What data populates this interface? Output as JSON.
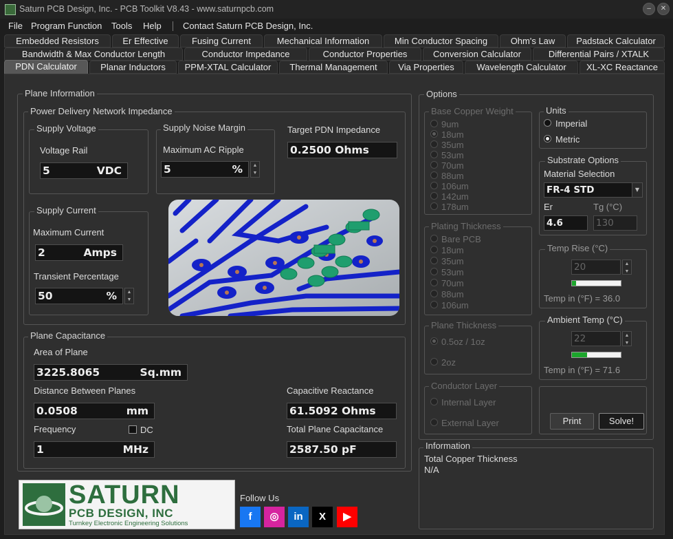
{
  "window": {
    "title": "Saturn PCB Design, Inc. - PCB Toolkit V8.43 - www.saturnpcb.com",
    "minimize": "–",
    "close": "✕"
  },
  "menu": [
    "File",
    "Program Function",
    "Tools",
    "Help",
    "Contact Saturn PCB Design, Inc."
  ],
  "tabs_row1": [
    "Embedded Resistors",
    "Er Effective",
    "Fusing Current",
    "Mechanical Information",
    "Min Conductor Spacing",
    "Ohm's Law",
    "Padstack Calculator"
  ],
  "tabs_row2": [
    "Bandwidth & Max Conductor Length",
    "Conductor Impedance",
    "Conductor Properties",
    "Conversion Calculator",
    "Differential Pairs / XTALK"
  ],
  "tabs_row3": [
    "PDN Calculator",
    "Planar Inductors",
    "PPM-XTAL Calculator",
    "Thermal Management",
    "Via Properties",
    "Wavelength Calculator",
    "XL-XC Reactance"
  ],
  "plane_info": {
    "title": "Plane Information",
    "pdn": {
      "title": "Power Delivery Network Impedance",
      "supply_voltage": {
        "title": "Supply Voltage",
        "label": "Voltage Rail",
        "value": "5",
        "unit": "VDC"
      },
      "noise_margin": {
        "title": "Supply Noise Margin",
        "label": "Maximum AC Ripple",
        "value": "5",
        "unit": "%"
      },
      "target": {
        "label": "Target PDN Impedance",
        "value": "0.2500 Ohms"
      },
      "supply_current": {
        "title": "Supply Current",
        "max_label": "Maximum Current",
        "max_value": "2",
        "max_unit": "Amps",
        "transient_label": "Transient Percentage",
        "transient_value": "50",
        "transient_unit": "%"
      }
    },
    "capacitance": {
      "title": "Plane Capacitance",
      "area_label": "Area of Plane",
      "area_value": "3225.8065",
      "area_unit": "Sq.mm",
      "distance_label": "Distance Between Planes",
      "distance_value": "0.0508",
      "distance_unit": "mm",
      "frequency_label": "Frequency",
      "frequency_value": "1",
      "frequency_unit": "MHz",
      "dc_label": "DC",
      "reactance_label": "Capacitive Reactance",
      "reactance_value": "61.5092 Ohms",
      "total_label": "Total Plane Capacitance",
      "total_value": "2587.50 pF"
    }
  },
  "logo": {
    "line1": "SATURN",
    "line2": "PCB DESIGN, INC",
    "line3": "Turnkey Electronic Engineering Solutions"
  },
  "follow": {
    "label": "Follow Us",
    "icons": [
      "f",
      "◎",
      "in",
      "X",
      "▶"
    ]
  },
  "options": {
    "title": "Options",
    "base_copper": {
      "title": "Base Copper Weight",
      "items": [
        "9um",
        "18um",
        "35um",
        "53um",
        "70um",
        "88um",
        "106um",
        "142um",
        "178um"
      ],
      "selected": "18um"
    },
    "plating": {
      "title": "Plating Thickness",
      "items": [
        "Bare PCB",
        "18um",
        "35um",
        "53um",
        "70um",
        "88um",
        "106um"
      ]
    },
    "plane_thickness": {
      "title": "Plane Thickness",
      "items": [
        "0.5oz / 1oz",
        "2oz"
      ],
      "selected": "0.5oz / 1oz"
    },
    "conductor_layer": {
      "title": "Conductor Layer",
      "items": [
        "Internal Layer",
        "External Layer"
      ]
    },
    "units": {
      "title": "Units",
      "items": [
        "Imperial",
        "Metric"
      ],
      "selected": "Metric"
    },
    "substrate": {
      "title": "Substrate Options",
      "material_label": "Material Selection",
      "material_value": "FR-4 STD",
      "er_label": "Er",
      "er_value": "4.6",
      "tg_label": "Tg (°C)",
      "tg_value": "130"
    },
    "temp_rise": {
      "title": "Temp Rise (°C)",
      "value": "20",
      "fahrenheit": "Temp in (°F) = 36.0",
      "level_percent": 8
    },
    "ambient": {
      "title": "Ambient Temp (°C)",
      "value": "22",
      "fahrenheit": "Temp in (°F) = 71.6",
      "level_percent": 31
    },
    "print_label": "Print",
    "solve_label": "Solve!"
  },
  "information": {
    "title": "Information",
    "line1": "Total Copper Thickness",
    "line2": "N/A"
  },
  "colors": {
    "background": "#2f2f2f",
    "progress_green": "#1ca62c",
    "trace_blue": "#1422c8",
    "pad_green": "#1f9e6e",
    "logo_green": "#2e6e3e"
  }
}
